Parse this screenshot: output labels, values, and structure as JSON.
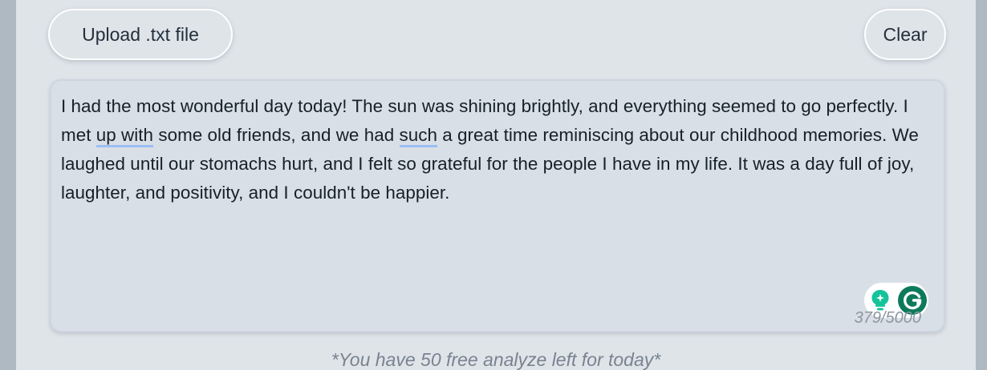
{
  "toolbar": {
    "upload_label": "Upload .txt file",
    "clear_label": "Clear"
  },
  "editor": {
    "segments": [
      {
        "text": "I had the most wonderful day today! The sun was shining brightly, and everything seemed to go perfectly. I met ",
        "highlight": false
      },
      {
        "text": "up with",
        "highlight": true
      },
      {
        "text": " some old friends, and we had ",
        "highlight": false
      },
      {
        "text": "such",
        "highlight": true
      },
      {
        "text": " a great time reminiscing about our childhood memories. We laughed until our stomachs hurt, and I felt so grateful for the people I have in my life. It was a day full of joy, laughter, and positivity, and I couldn't be happier.",
        "highlight": false
      }
    ],
    "char_count": "379/5000",
    "assistant_icons": [
      "lightbulb-icon",
      "grammarly-g-icon"
    ]
  },
  "footer": {
    "note": "*You have 50 free analyze left for today*"
  },
  "colors": {
    "page_bg": "#aeb9c1",
    "panel_bg": "#dfe4e9",
    "textarea_bg": "#d8dfe6",
    "underline": "#9cbef4",
    "grammarly_green": "#15c39a",
    "grammarly_dark": "#0b7a5a"
  }
}
